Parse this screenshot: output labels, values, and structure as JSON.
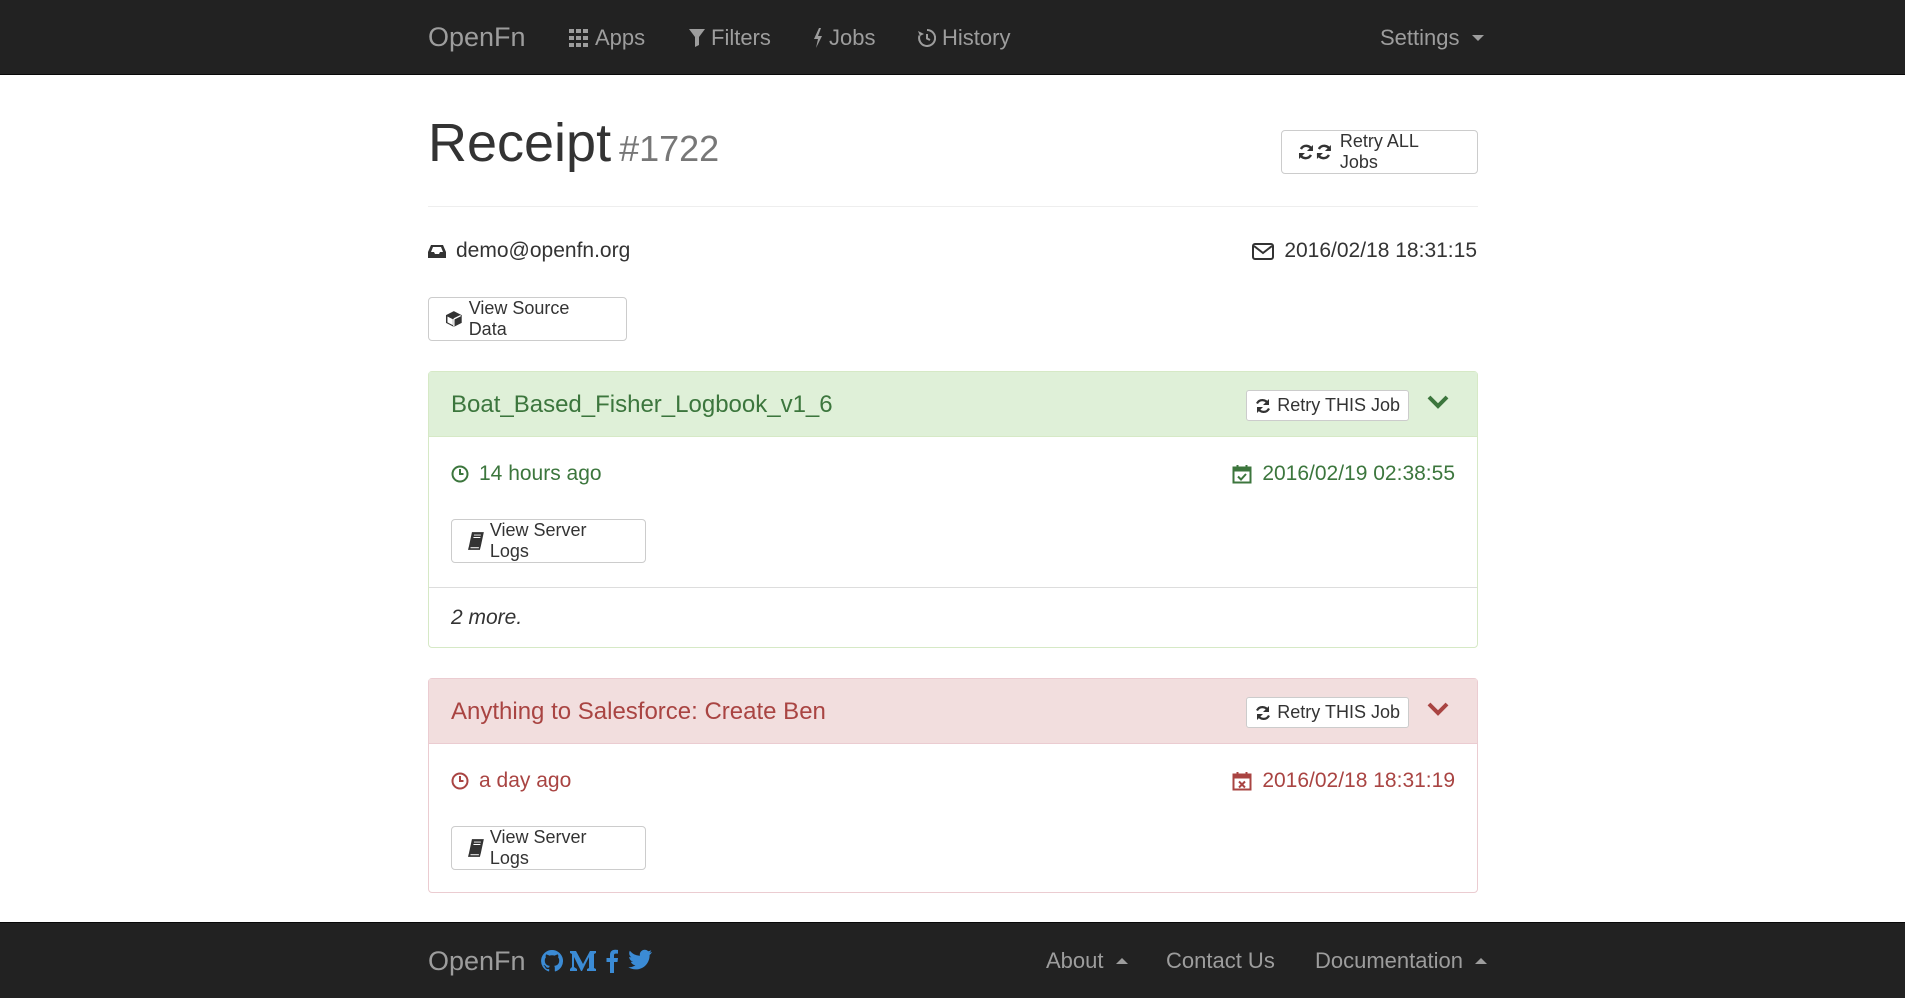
{
  "nav": {
    "brand": "OpenFn",
    "items": [
      {
        "label": "Apps",
        "icon": "grid-icon"
      },
      {
        "label": "Filters",
        "icon": "filter-icon"
      },
      {
        "label": "Jobs",
        "icon": "bolt-icon"
      },
      {
        "label": "History",
        "icon": "history-icon"
      }
    ],
    "settings": "Settings"
  },
  "receipt": {
    "title": "Receipt",
    "number": "#1722",
    "retry_all": "Retry ALL Jobs",
    "source": "demo@openfn.org",
    "received": "2016/02/18 18:31:15",
    "view_source": "View Source Data"
  },
  "jobs": [
    {
      "name": "Boat_Based_Fisher_Logbook_v1_6",
      "status": "success",
      "retry_label": "Retry THIS Job",
      "relative_time": "14 hours ago",
      "timestamp": "2016/02/19 02:38:55",
      "logs_label": "View Server Logs",
      "more": "2 more."
    },
    {
      "name": "Anything to Salesforce: Create Ben",
      "status": "failure",
      "retry_label": "Retry THIS Job",
      "relative_time": "a day ago",
      "timestamp": "2016/02/18 18:31:19",
      "logs_label": "View Server Logs"
    }
  ],
  "footer": {
    "brand": "OpenFn",
    "social": [
      "github-icon",
      "medium-icon",
      "facebook-icon",
      "twitter-icon"
    ],
    "about": "About",
    "contact": "Contact Us",
    "documentation": "Documentation"
  },
  "colors": {
    "navbar": "#222222",
    "success_text": "#3c763d",
    "success_bg": "#dff0d8",
    "danger_text": "#a94442",
    "danger_bg": "#f2dede",
    "social": "#3b8bd5"
  }
}
